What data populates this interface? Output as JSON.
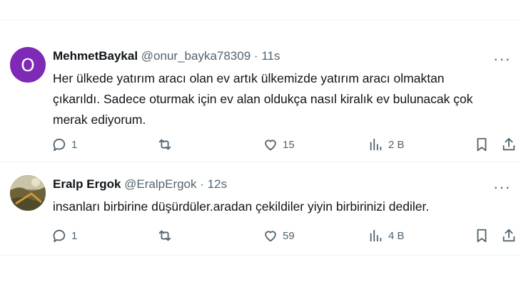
{
  "tweets": [
    {
      "avatar_letter": "O",
      "name": "MehmetBaykal",
      "handle": "@onur_bayka78309",
      "separator": "·",
      "time": "11s",
      "text_lines": [
        "Her ülkede yatırım aracı olan ev artık ülkemizde yatırım aracı olmaktan",
        "çıkarıldı. Sadece oturmak için ev alan oldukça nasıl kiralık ev bulunacak çok",
        "merak ediyorum."
      ],
      "replies": "1",
      "likes": "15",
      "views": "2 B",
      "more_label": "···"
    },
    {
      "name": "Eralp Ergok",
      "handle": "@EralpErgok",
      "separator": "·",
      "time": "12s",
      "text_lines": [
        "insanları birbirine düşürdüler.aradan çekildiler yiyin birbirinizi dediler."
      ],
      "replies": "1",
      "likes": "59",
      "views": "4 B",
      "more_label": "···"
    }
  ],
  "icons": {
    "avatar_color": "#7e2ab6",
    "action_color": "#536471"
  }
}
